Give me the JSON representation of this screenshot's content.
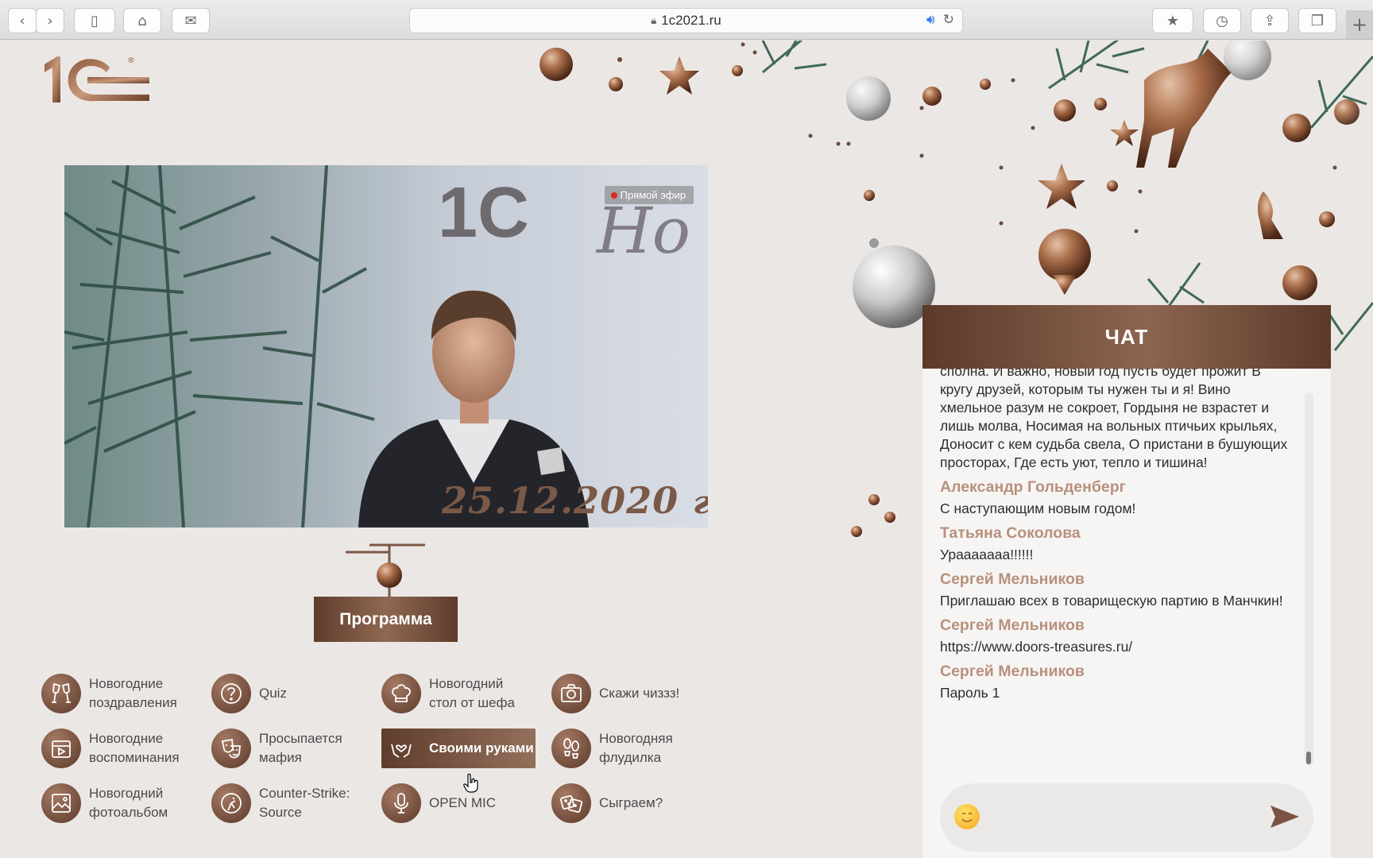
{
  "browser": {
    "url": "1c2021.ru"
  },
  "site": {
    "logo_text": "1С",
    "logo_registered": "®"
  },
  "video": {
    "live_label": "Прямой эфир",
    "backdrop_text": "Но",
    "date_text": "25.12.2020",
    "date_suffix": "год"
  },
  "program": {
    "label": "Программа"
  },
  "menu": {
    "items": [
      {
        "label": "Новогодние\nпоздравления",
        "icon": "champagne-glasses-icon"
      },
      {
        "label": "Quiz",
        "icon": "question-icon"
      },
      {
        "label": "Новогодний\nстол от шефа",
        "icon": "chef-hat-icon"
      },
      {
        "label": "Скажи чиззз!",
        "icon": "camera-icon"
      },
      {
        "label": "Новогодние\nвоспоминания",
        "icon": "video-icon"
      },
      {
        "label": "Просыпается\nмафия",
        "icon": "theater-masks-icon"
      },
      {
        "label": "Своими руками",
        "icon": "hands-heart-icon"
      },
      {
        "label": "Новогодняя\nфлудилка",
        "icon": "footprints-icon"
      },
      {
        "label": "Новогодний\nфотоальбом",
        "icon": "image-icon"
      },
      {
        "label": "Counter-Strike:\nSource",
        "icon": "counter-strike-icon"
      },
      {
        "label": "OPEN MIC",
        "icon": "microphone-icon"
      },
      {
        "label": "Сыграем?",
        "icon": "dice-icon"
      }
    ]
  },
  "chat": {
    "title": "ЧАТ",
    "messages": [
      {
        "author": "",
        "text": "сполна. И важно, новый год пусть будет прожит В кругу друзей, которым ты нужен ты и я! Вино хмельное разум не сокроет, Гордыня не взрастет и лишь молва, Носимая на вольных птичьих крыльях, Доносит с кем судьба свела, О пристани в бушующих просторах, Где есть уют, тепло и тишина!"
      },
      {
        "author": "Александр Гольденберг",
        "text": "С наступающим новым годом!"
      },
      {
        "author": "Татьяна Соколова",
        "text": "Урааааааа!!!!!!"
      },
      {
        "author": "Сергей Мельников",
        "text": "Приглашаю всех в товарищескую партию в Манчкин!"
      },
      {
        "author": "Сергей Мельников",
        "text": "https://www.doors-treasures.ru/"
      },
      {
        "author": "Сергей Мельников",
        "text": "Пароль 1"
      }
    ]
  },
  "colors": {
    "accent": "#8c6550",
    "author": "#b7917c",
    "background": "#ebe7e5"
  }
}
